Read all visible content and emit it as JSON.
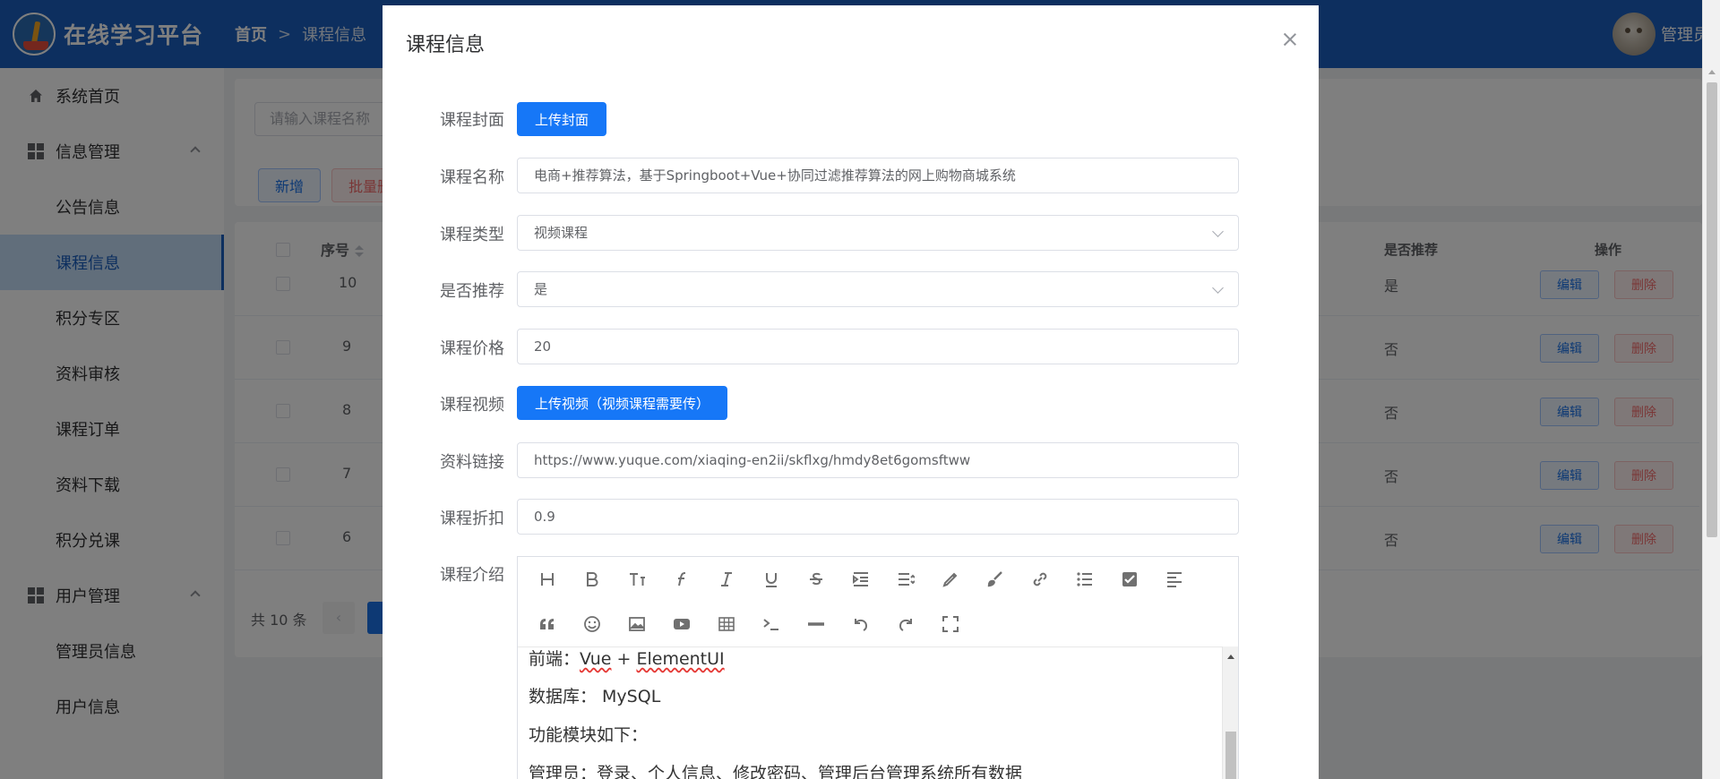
{
  "app": {
    "title": "在线学习平台",
    "user_name": "管理员"
  },
  "breadcrumb": {
    "home": "首页",
    "separator": ">",
    "current": "课程信息"
  },
  "sidebar": {
    "items": [
      {
        "label": "系统首页",
        "icon": "home-icon",
        "type": "parent"
      },
      {
        "label": "信息管理",
        "icon": "grid-icon",
        "type": "group"
      },
      {
        "label": "公告信息",
        "type": "child"
      },
      {
        "label": "课程信息",
        "type": "child",
        "active": true
      },
      {
        "label": "积分专区",
        "type": "child"
      },
      {
        "label": "资料审核",
        "type": "child"
      },
      {
        "label": "课程订单",
        "type": "child"
      },
      {
        "label": "资料下载",
        "type": "child"
      },
      {
        "label": "积分兑课",
        "type": "child"
      },
      {
        "label": "用户管理",
        "icon": "grid-icon",
        "type": "group"
      },
      {
        "label": "管理员信息",
        "type": "child"
      },
      {
        "label": "用户信息",
        "type": "child"
      }
    ]
  },
  "main": {
    "search_placeholder": "请输入课程名称",
    "add_label": "新增",
    "batch_delete_label": "批量删除",
    "table": {
      "headers": {
        "index": "序号",
        "recommend": "是否推荐",
        "actions": "操作"
      },
      "rows": [
        {
          "index": "10",
          "recommend": "是"
        },
        {
          "index": "9",
          "recommend": "否"
        },
        {
          "index": "8",
          "recommend": "否"
        },
        {
          "index": "7",
          "recommend": "否"
        },
        {
          "index": "6",
          "recommend": "否"
        }
      ],
      "edit_label": "编辑",
      "delete_label": "删除"
    },
    "pagination": {
      "total": "共 10 条"
    }
  },
  "dialog": {
    "title": "课程信息",
    "fields": {
      "cover": {
        "label": "课程封面",
        "button": "上传封面"
      },
      "name": {
        "label": "课程名称",
        "value": "电商+推荐算法，基于Springboot+Vue+协同过滤推荐算法的网上购物商城系统"
      },
      "type": {
        "label": "课程类型",
        "value": "视频课程"
      },
      "recommend": {
        "label": "是否推荐",
        "value": "是"
      },
      "price": {
        "label": "课程价格",
        "value": "20"
      },
      "video": {
        "label": "课程视频",
        "button": "上传视频（视频课程需要传）"
      },
      "link": {
        "label": "资料链接",
        "value": "https://www.yuque.com/xiaqing-en2ii/skflxg/hmdy8et6gomsftww"
      },
      "discount": {
        "label": "课程折扣",
        "value": "0.9"
      },
      "intro": {
        "label": "课程介绍",
        "lines": {
          "l1_prefix": "前端：",
          "l1_vue": "Vue",
          "l1_plus": " + ",
          "l1_elui": "ElementUI",
          "l2": "数据库：  MySQL",
          "l3": "功能模块如下：",
          "l4": "管理员：登录、个人信息、修改密码、管理后台管理系统所有数据"
        }
      }
    },
    "toolbar_icons": [
      "heading-icon",
      "bold-icon",
      "font-size-icon",
      "font-family-icon",
      "italic-icon",
      "underline-icon",
      "strikethrough-icon",
      "indent-icon",
      "line-height-icon",
      "font-color-icon",
      "background-color-icon",
      "link-icon",
      "bulleted-list-icon",
      "todo-icon",
      "align-left-icon",
      "blockquote-icon",
      "emoji-icon",
      "image-icon",
      "video-icon",
      "table-icon",
      "code-icon",
      "divider-icon",
      "undo-icon",
      "redo-icon",
      "fullscreen-icon"
    ]
  }
}
